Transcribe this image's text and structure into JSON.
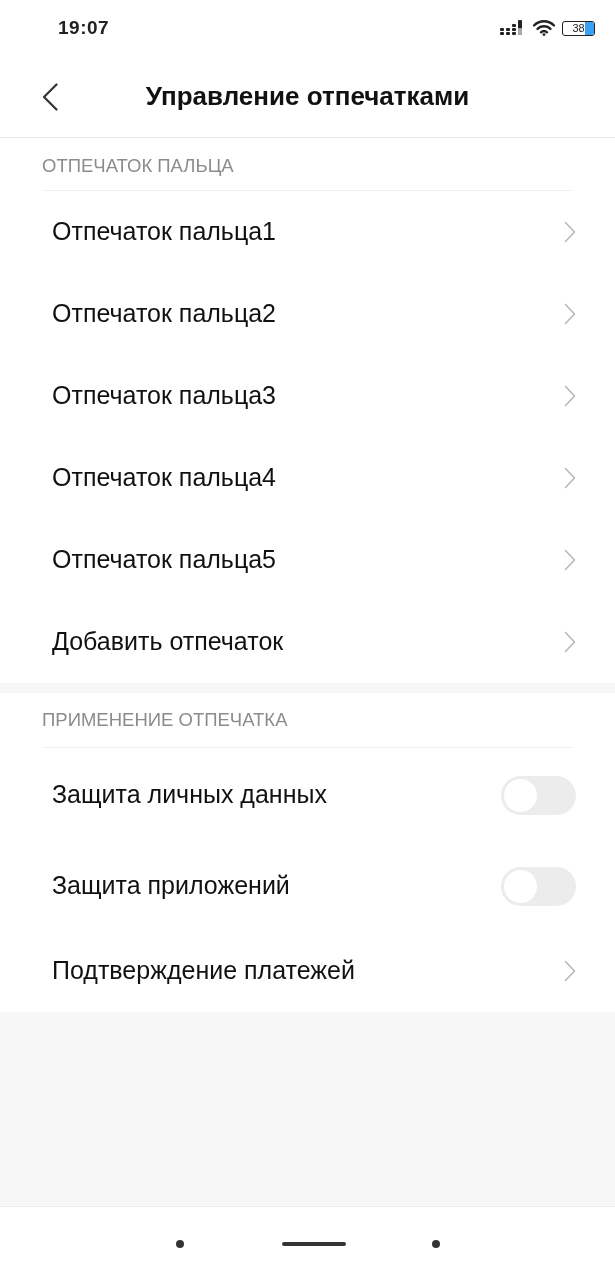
{
  "status_bar": {
    "time": "19:07",
    "battery": "38"
  },
  "header": {
    "title": "Управление отпечатками"
  },
  "sections": [
    {
      "title": "ОТПЕЧАТОК ПАЛЬЦА",
      "items": [
        {
          "kind": "link",
          "label": "Отпечаток пальца1"
        },
        {
          "kind": "link",
          "label": "Отпечаток пальца2"
        },
        {
          "kind": "link",
          "label": "Отпечаток пальца3"
        },
        {
          "kind": "link",
          "label": "Отпечаток пальца4"
        },
        {
          "kind": "link",
          "label": "Отпечаток пальца5"
        },
        {
          "kind": "link",
          "label": "Добавить отпечаток"
        }
      ]
    },
    {
      "title": "ПРИМЕНЕНИЕ ОТПЕЧАТКА",
      "items": [
        {
          "kind": "toggle",
          "label": "Защита личных данных",
          "on": false
        },
        {
          "kind": "toggle",
          "label": "Защита приложений",
          "on": false
        },
        {
          "kind": "link",
          "label": "Подтверждение платежей"
        }
      ]
    }
  ]
}
